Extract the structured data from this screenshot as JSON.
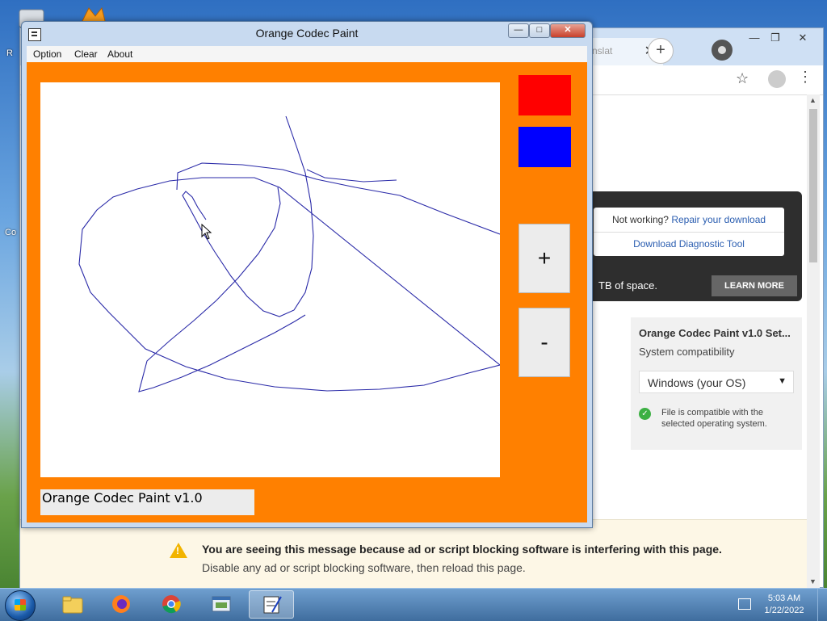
{
  "desktop": {
    "left_label_1": "R",
    "left_label_2": "Co"
  },
  "browser": {
    "tab_title": "nslat",
    "tab_close": "✕",
    "new_tab": "+",
    "win_minimize": "—",
    "win_restore": "❐",
    "win_close": "✕",
    "bookmark_icon": "☆",
    "menu_icon": "⋮",
    "help": {
      "not_working": "Not working? ",
      "repair_link": "Repair your download",
      "diagnostic_link": "Download Diagnostic Tool"
    },
    "space_text": "TB of space.",
    "learn_more": "LEARN MORE",
    "compat": {
      "title": "Orange Codec Paint v1.0 Set...",
      "subtitle": "System compatibility",
      "os_selected": "Windows (your OS)",
      "ok_icon": "✓",
      "ok_text": "File is compatible with the selected operating system."
    },
    "adblock": {
      "line1": "You are seeing this message because ad or script blocking software is interfering with this page.",
      "line2": "Disable any ad or script blocking software, then reload this page."
    },
    "scroll_up": "▲",
    "scroll_down": "▼"
  },
  "paint": {
    "title": "Orange Codec Paint",
    "minimize": "—",
    "maximize": "□",
    "close": "✕",
    "menu": [
      "Option",
      "Clear",
      "About"
    ],
    "brush_colors": [
      "#ff0000",
      "#0000ff"
    ],
    "increase_label": "+",
    "decrease_label": "-",
    "status": "Orange Codec Paint v1.0",
    "stroke_color": "#2a2aa8"
  },
  "taskbar": {
    "time": "5:03 AM",
    "date": "1/22/2022"
  }
}
